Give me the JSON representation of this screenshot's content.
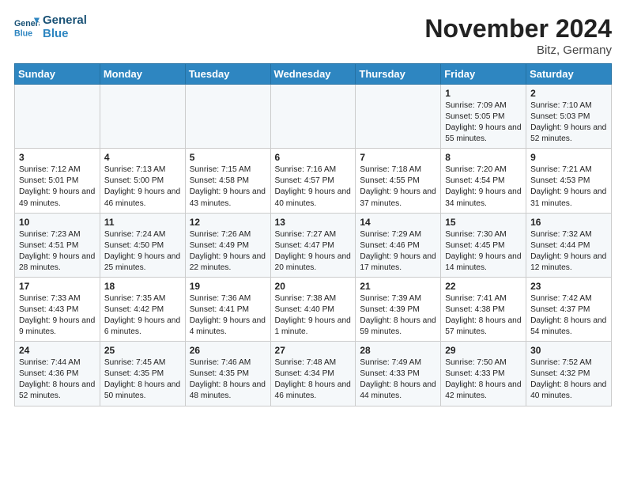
{
  "logo": {
    "line1": "General",
    "line2": "Blue"
  },
  "title": "November 2024",
  "location": "Bitz, Germany",
  "days_header": [
    "Sunday",
    "Monday",
    "Tuesday",
    "Wednesday",
    "Thursday",
    "Friday",
    "Saturday"
  ],
  "weeks": [
    [
      {
        "day": "",
        "info": ""
      },
      {
        "day": "",
        "info": ""
      },
      {
        "day": "",
        "info": ""
      },
      {
        "day": "",
        "info": ""
      },
      {
        "day": "",
        "info": ""
      },
      {
        "day": "1",
        "info": "Sunrise: 7:09 AM\nSunset: 5:05 PM\nDaylight: 9 hours and 55 minutes."
      },
      {
        "day": "2",
        "info": "Sunrise: 7:10 AM\nSunset: 5:03 PM\nDaylight: 9 hours and 52 minutes."
      }
    ],
    [
      {
        "day": "3",
        "info": "Sunrise: 7:12 AM\nSunset: 5:01 PM\nDaylight: 9 hours and 49 minutes."
      },
      {
        "day": "4",
        "info": "Sunrise: 7:13 AM\nSunset: 5:00 PM\nDaylight: 9 hours and 46 minutes."
      },
      {
        "day": "5",
        "info": "Sunrise: 7:15 AM\nSunset: 4:58 PM\nDaylight: 9 hours and 43 minutes."
      },
      {
        "day": "6",
        "info": "Sunrise: 7:16 AM\nSunset: 4:57 PM\nDaylight: 9 hours and 40 minutes."
      },
      {
        "day": "7",
        "info": "Sunrise: 7:18 AM\nSunset: 4:55 PM\nDaylight: 9 hours and 37 minutes."
      },
      {
        "day": "8",
        "info": "Sunrise: 7:20 AM\nSunset: 4:54 PM\nDaylight: 9 hours and 34 minutes."
      },
      {
        "day": "9",
        "info": "Sunrise: 7:21 AM\nSunset: 4:53 PM\nDaylight: 9 hours and 31 minutes."
      }
    ],
    [
      {
        "day": "10",
        "info": "Sunrise: 7:23 AM\nSunset: 4:51 PM\nDaylight: 9 hours and 28 minutes."
      },
      {
        "day": "11",
        "info": "Sunrise: 7:24 AM\nSunset: 4:50 PM\nDaylight: 9 hours and 25 minutes."
      },
      {
        "day": "12",
        "info": "Sunrise: 7:26 AM\nSunset: 4:49 PM\nDaylight: 9 hours and 22 minutes."
      },
      {
        "day": "13",
        "info": "Sunrise: 7:27 AM\nSunset: 4:47 PM\nDaylight: 9 hours and 20 minutes."
      },
      {
        "day": "14",
        "info": "Sunrise: 7:29 AM\nSunset: 4:46 PM\nDaylight: 9 hours and 17 minutes."
      },
      {
        "day": "15",
        "info": "Sunrise: 7:30 AM\nSunset: 4:45 PM\nDaylight: 9 hours and 14 minutes."
      },
      {
        "day": "16",
        "info": "Sunrise: 7:32 AM\nSunset: 4:44 PM\nDaylight: 9 hours and 12 minutes."
      }
    ],
    [
      {
        "day": "17",
        "info": "Sunrise: 7:33 AM\nSunset: 4:43 PM\nDaylight: 9 hours and 9 minutes."
      },
      {
        "day": "18",
        "info": "Sunrise: 7:35 AM\nSunset: 4:42 PM\nDaylight: 9 hours and 6 minutes."
      },
      {
        "day": "19",
        "info": "Sunrise: 7:36 AM\nSunset: 4:41 PM\nDaylight: 9 hours and 4 minutes."
      },
      {
        "day": "20",
        "info": "Sunrise: 7:38 AM\nSunset: 4:40 PM\nDaylight: 9 hours and 1 minute."
      },
      {
        "day": "21",
        "info": "Sunrise: 7:39 AM\nSunset: 4:39 PM\nDaylight: 8 hours and 59 minutes."
      },
      {
        "day": "22",
        "info": "Sunrise: 7:41 AM\nSunset: 4:38 PM\nDaylight: 8 hours and 57 minutes."
      },
      {
        "day": "23",
        "info": "Sunrise: 7:42 AM\nSunset: 4:37 PM\nDaylight: 8 hours and 54 minutes."
      }
    ],
    [
      {
        "day": "24",
        "info": "Sunrise: 7:44 AM\nSunset: 4:36 PM\nDaylight: 8 hours and 52 minutes."
      },
      {
        "day": "25",
        "info": "Sunrise: 7:45 AM\nSunset: 4:35 PM\nDaylight: 8 hours and 50 minutes."
      },
      {
        "day": "26",
        "info": "Sunrise: 7:46 AM\nSunset: 4:35 PM\nDaylight: 8 hours and 48 minutes."
      },
      {
        "day": "27",
        "info": "Sunrise: 7:48 AM\nSunset: 4:34 PM\nDaylight: 8 hours and 46 minutes."
      },
      {
        "day": "28",
        "info": "Sunrise: 7:49 AM\nSunset: 4:33 PM\nDaylight: 8 hours and 44 minutes."
      },
      {
        "day": "29",
        "info": "Sunrise: 7:50 AM\nSunset: 4:33 PM\nDaylight: 8 hours and 42 minutes."
      },
      {
        "day": "30",
        "info": "Sunrise: 7:52 AM\nSunset: 4:32 PM\nDaylight: 8 hours and 40 minutes."
      }
    ]
  ]
}
